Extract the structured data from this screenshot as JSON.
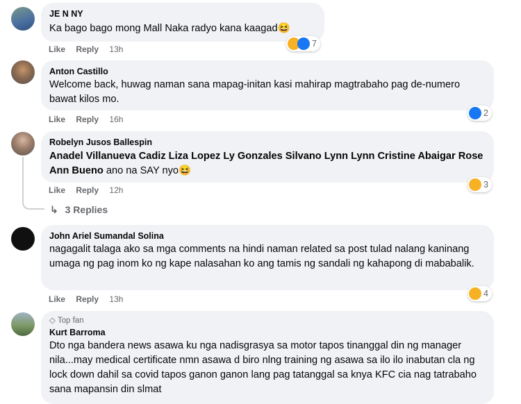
{
  "actions": {
    "like": "Like",
    "reply": "Reply"
  },
  "comments": [
    {
      "name": "JE N NY",
      "text": "Ka bago bago mong Mall Naka radyo kana kaagad",
      "emoji": "😆",
      "time": "13h",
      "reactions": "7"
    },
    {
      "name": "Anton Castillo",
      "text": "Welcome back, huwag naman sana mapag-initan kasi mahirap magtrabaho pag de-numero bawat kilos mo.",
      "time": "16h",
      "reactions": "2"
    },
    {
      "name": "Robelyn Jusos Ballespin",
      "tags": "Anadel Villanueva Cadiz Liza Lopez Ly Gonzales Silvano Lynn Lynn Cristine Abaigar Rose Ann Bueno",
      "text": " ano na SAY nyo",
      "emoji": "😆",
      "time": "12h",
      "reactions": "3",
      "replies": "3 Replies"
    },
    {
      "name": "John Ariel Sumandal Solina",
      "text": "nagagalit talaga ako sa mga comments na hindi naman related sa post tulad nalang kaninang umaga ng pag inom ko ng kape nalasahan ko ang tamis ng sandali ng kahapong di mababalik.",
      "time": "13h",
      "reactions": "4"
    },
    {
      "badge": "Top fan",
      "name": "Kurt Barroma",
      "text": "Dto nga bandera news asawa ku nga nadisgrasya sa motor tapos tinanggal din ng manager nila...may medical certificate nmn asawa d biro nlng training ng asawa sa ilo ilo inabutan cla ng lock down dahil sa covid tapos ganon ganon lang pag tatanggal sa knya KFC cia nag tatrabaho sana mapansin din slmat"
    }
  ],
  "colors": {
    "bubble": "#f0f2f5",
    "meta": "#65676b",
    "like": "#1877f2",
    "haha": "#f7b125",
    "line": "#ced0d4"
  }
}
